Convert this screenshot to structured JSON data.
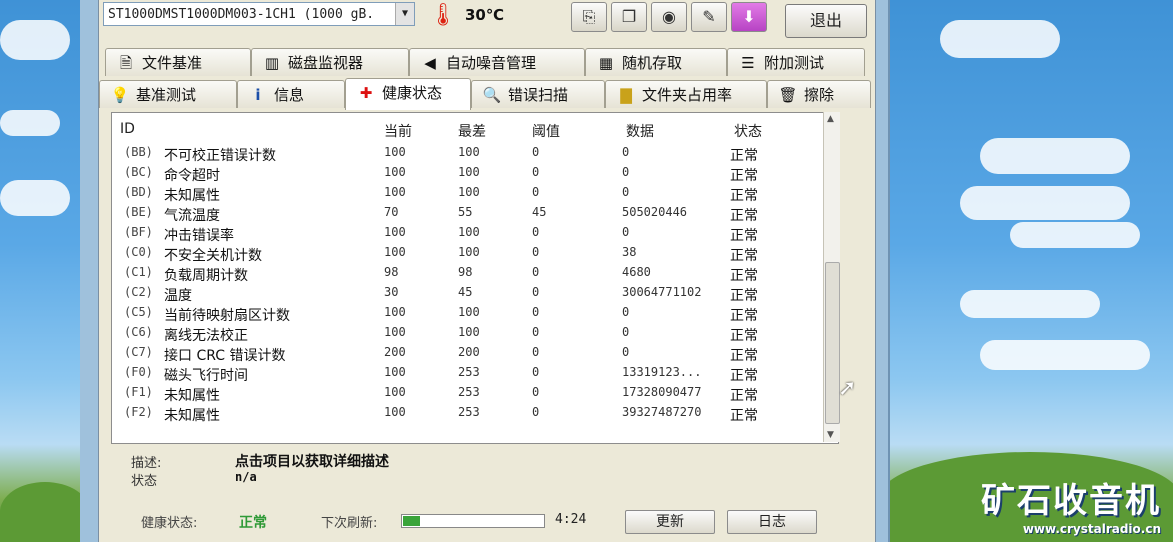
{
  "toolbar": {
    "drive": "ST1000DMST1000DM003-1CH1 (1000 gB.",
    "temperature": "30℃",
    "exit_label": "退出"
  },
  "tabs_top": [
    {
      "label": "文件基准",
      "icon": "doc-icon"
    },
    {
      "label": "磁盘监视器",
      "icon": "chart-icon"
    },
    {
      "label": "自动噪音管理",
      "icon": "speaker-icon"
    },
    {
      "label": "随机存取",
      "icon": "grid-icon"
    },
    {
      "label": "附加测试",
      "icon": "list-icon"
    }
  ],
  "tabs_bottom": [
    {
      "label": "基准测试",
      "icon": "bulb-icon"
    },
    {
      "label": "信息",
      "icon": "info-icon"
    },
    {
      "label": "健康状态",
      "icon": "cross-icon",
      "active": true
    },
    {
      "label": "错误扫描",
      "icon": "magnifier-icon"
    },
    {
      "label": "文件夹占用率",
      "icon": "folder-icon"
    },
    {
      "label": "擦除",
      "icon": "trash-icon"
    }
  ],
  "table": {
    "headers": [
      "ID",
      "当前",
      "最差",
      "阈值",
      "数据",
      "状态"
    ],
    "rows": [
      {
        "id": "(BB)",
        "name": "不可校正错误计数",
        "cur": "100",
        "worst": "100",
        "thr": "0",
        "data": "0",
        "status": "正常"
      },
      {
        "id": "(BC)",
        "name": "命令超时",
        "cur": "100",
        "worst": "100",
        "thr": "0",
        "data": "0",
        "status": "正常"
      },
      {
        "id": "(BD)",
        "name": "未知属性",
        "cur": "100",
        "worst": "100",
        "thr": "0",
        "data": "0",
        "status": "正常"
      },
      {
        "id": "(BE)",
        "name": "气流温度",
        "cur": "70",
        "worst": "55",
        "thr": "45",
        "data": "505020446",
        "status": "正常"
      },
      {
        "id": "(BF)",
        "name": "冲击错误率",
        "cur": "100",
        "worst": "100",
        "thr": "0",
        "data": "0",
        "status": "正常"
      },
      {
        "id": "(C0)",
        "name": "不安全关机计数",
        "cur": "100",
        "worst": "100",
        "thr": "0",
        "data": "38",
        "status": "正常"
      },
      {
        "id": "(C1)",
        "name": "负载周期计数",
        "cur": "98",
        "worst": "98",
        "thr": "0",
        "data": "4680",
        "status": "正常"
      },
      {
        "id": "(C2)",
        "name": "温度",
        "cur": "30",
        "worst": "45",
        "thr": "0",
        "data": "30064771102",
        "status": "正常"
      },
      {
        "id": "(C5)",
        "name": "当前待映射扇区计数",
        "cur": "100",
        "worst": "100",
        "thr": "0",
        "data": "0",
        "status": "正常"
      },
      {
        "id": "(C6)",
        "name": "离线无法校正",
        "cur": "100",
        "worst": "100",
        "thr": "0",
        "data": "0",
        "status": "正常"
      },
      {
        "id": "(C7)",
        "name": "接口 CRC 错误计数",
        "cur": "200",
        "worst": "200",
        "thr": "0",
        "data": "0",
        "status": "正常"
      },
      {
        "id": "(F0)",
        "name": "磁头飞行时间",
        "cur": "100",
        "worst": "253",
        "thr": "0",
        "data": "13319123...",
        "status": "正常"
      },
      {
        "id": "(F1)",
        "name": "未知属性",
        "cur": "100",
        "worst": "253",
        "thr": "0",
        "data": "17328090477",
        "status": "正常"
      },
      {
        "id": "(F2)",
        "name": "未知属性",
        "cur": "100",
        "worst": "253",
        "thr": "0",
        "data": "39327487270",
        "status": "正常"
      }
    ]
  },
  "description": {
    "desc_label": "描述:",
    "desc_value": "点击项目以获取详细描述",
    "status_label": "状态",
    "status_value": "n/a"
  },
  "statusbar": {
    "health_label": "健康状态:",
    "health_value": "正常",
    "refresh_label": "下次刷新:",
    "progress_fraction": 0.12,
    "timer": "4:24",
    "refresh_button": "更新",
    "log_button": "日志"
  },
  "watermark": {
    "title": "矿石收音机",
    "url": "www.crystalradio.cn"
  },
  "colors": {
    "ok_green": "#2e9a36",
    "panel": "#ece9d8"
  }
}
